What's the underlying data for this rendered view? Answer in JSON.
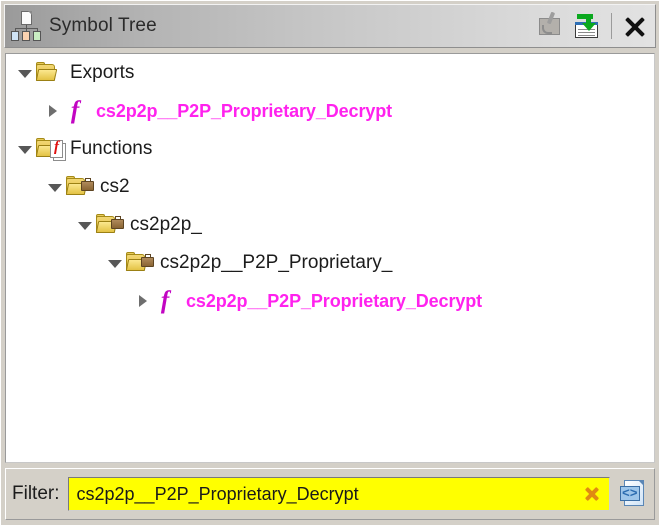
{
  "window": {
    "title": "Symbol Tree",
    "title_icon": "symbol-tree-icon"
  },
  "titlebar": {
    "actions": [
      {
        "name": "pin-icon",
        "label": "Pin / Stamp",
        "enabled": false
      },
      {
        "name": "snapshot-icon",
        "label": "Snapshot Window",
        "enabled": true
      },
      {
        "name": "close-icon",
        "label": "Close",
        "enabled": true
      }
    ]
  },
  "tree": {
    "nodes": [
      {
        "label": "Exports",
        "icon": "folder-open-icon",
        "twisty": "open",
        "depth": 0,
        "kind": "folder",
        "selected": false
      },
      {
        "label": "cs2p2p__P2P_Proprietary_Decrypt",
        "icon": "function-icon",
        "twisty": "closed",
        "depth": 1,
        "kind": "function",
        "selected": false
      },
      {
        "label": "Functions",
        "icon": "folder-functions-icon",
        "twisty": "open",
        "depth": 0,
        "kind": "folder",
        "selected": false
      },
      {
        "label": "cs2",
        "icon": "folder-namespace-icon",
        "twisty": "open",
        "depth": 1,
        "kind": "namespace",
        "selected": false
      },
      {
        "label": "cs2p2p_",
        "icon": "folder-namespace-icon",
        "twisty": "open",
        "depth": 2,
        "kind": "namespace",
        "selected": false
      },
      {
        "label": "cs2p2p__P2P_Proprietary_",
        "icon": "folder-namespace-icon",
        "twisty": "open",
        "depth": 3,
        "kind": "namespace",
        "selected": false
      },
      {
        "label": "cs2p2p__P2P_Proprietary_Decrypt",
        "icon": "function-icon",
        "twisty": "closed",
        "depth": 4,
        "kind": "function",
        "selected": false
      }
    ]
  },
  "filter": {
    "label": "Filter:",
    "value": "cs2p2p__P2P_Proprietary_Decrypt",
    "placeholder": "",
    "clear_icon": "clear-filter-icon",
    "options_icon": "filter-options-icon"
  },
  "colors": {
    "function_text": "#ff22ee",
    "folder_text": "#1c1c1c",
    "filter_field_bg": "#ffff00",
    "clear_icon": "#e08a12",
    "snapshot_arrow": "#0aa81e",
    "panel_bg": "#d4d0c8"
  }
}
